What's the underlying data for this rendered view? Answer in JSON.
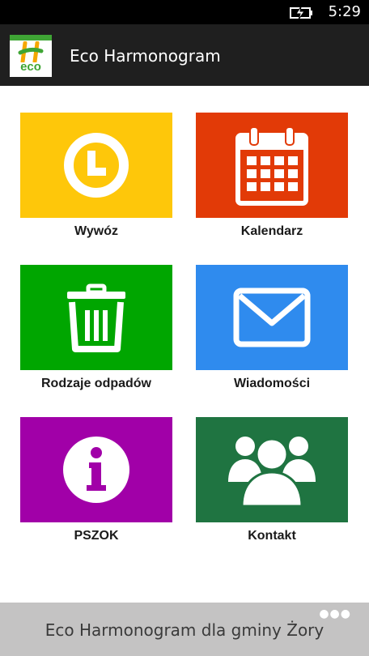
{
  "status_bar": {
    "time": "5:29",
    "battery_icon": "battery-charging-icon"
  },
  "app_bar": {
    "title": "Eco Harmonogram",
    "logo_text": "eco"
  },
  "tiles": [
    {
      "label": "Wywóz",
      "color": "#fec70a",
      "icon": "clock-icon"
    },
    {
      "label": "Kalendarz",
      "color": "#e23a07",
      "icon": "calendar-icon"
    },
    {
      "label": "Rodzaje odpadów",
      "color": "#00a600",
      "icon": "trash-icon"
    },
    {
      "label": "Wiadomości",
      "color": "#2f8bee",
      "icon": "mail-icon"
    },
    {
      "label": "PSZOK",
      "color": "#a100a8",
      "icon": "info-icon"
    },
    {
      "label": "Kontakt",
      "color": "#1f7441",
      "icon": "contacts-icon"
    }
  ],
  "bottom_bar": {
    "title": "Eco Harmonogram dla gminy Żory",
    "more_icon": "more-dots-icon"
  },
  "colors": {
    "status_bar": "#000000",
    "app_bar": "#1f1f1f",
    "bottom_bar": "#c4c3c3",
    "logo_green": "#3fa535"
  }
}
